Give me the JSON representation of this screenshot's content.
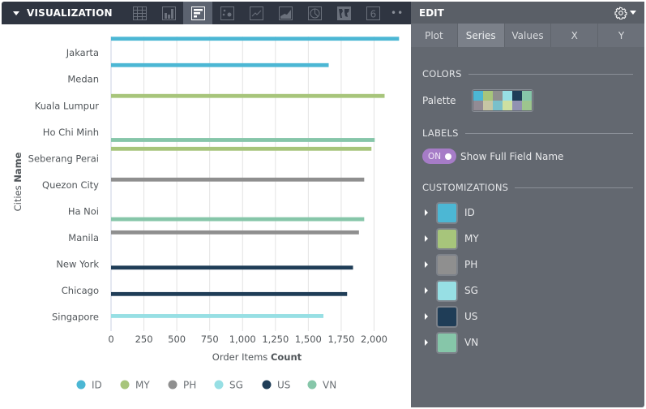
{
  "toolbar": {
    "title": "VISUALIZATION",
    "icons": [
      {
        "name": "table-icon",
        "active": false
      },
      {
        "name": "column-chart-icon",
        "active": false
      },
      {
        "name": "bar-chart-icon",
        "active": true
      },
      {
        "name": "scatter-chart-icon",
        "active": false
      },
      {
        "name": "line-chart-icon",
        "active": false
      },
      {
        "name": "area-chart-icon",
        "active": false
      },
      {
        "name": "pie-chart-icon",
        "active": false
      },
      {
        "name": "map-icon",
        "active": false
      },
      {
        "name": "single-value-icon",
        "active": false
      }
    ],
    "single_value_glyph": "6",
    "more_glyph": "••"
  },
  "edit": {
    "title": "EDIT",
    "tabs": [
      {
        "label": "Plot",
        "active": false
      },
      {
        "label": "Series",
        "active": true
      },
      {
        "label": "Values",
        "active": false
      },
      {
        "label": "X",
        "active": false
      },
      {
        "label": "Y",
        "active": false
      }
    ],
    "colors_heading": "COLORS",
    "palette_label": "Palette",
    "palette": [
      "#4cb7d4",
      "#a7c57b",
      "#8f8f8f",
      "#97dfe4",
      "#1f3d57",
      "#86c6a9",
      "#928b94",
      "#c6c6a4",
      "#7ac0ca",
      "#cde0a1",
      "#9191b2",
      "#9dc58e"
    ],
    "labels_heading": "LABELS",
    "toggle_state": "ON",
    "toggle_label": "Show Full Field Name",
    "customizations_heading": "CUSTOMIZATIONS",
    "customizations": [
      {
        "name": "ID",
        "color": "#4cb7d4"
      },
      {
        "name": "MY",
        "color": "#a7c57b"
      },
      {
        "name": "PH",
        "color": "#8f8f8f"
      },
      {
        "name": "SG",
        "color": "#97dfe4"
      },
      {
        "name": "US",
        "color": "#1f3d57"
      },
      {
        "name": "VN",
        "color": "#86c6a9"
      }
    ]
  },
  "chart_data": {
    "type": "bar",
    "orientation": "horizontal",
    "title": "",
    "xlabel_prefix": "Order Items ",
    "xlabel_bold": "Count",
    "ylabel_prefix": "Cities ",
    "ylabel_bold": "Name",
    "xlim": [
      0,
      2200
    ],
    "xticks": [
      0,
      250,
      500,
      750,
      1000,
      1250,
      1500,
      1750,
      2000
    ],
    "xtick_labels": [
      "0",
      "250",
      "500",
      "750",
      "1,000",
      "1,250",
      "1,500",
      "1,750",
      "2,000"
    ],
    "grid": true,
    "legend_position": "bottom",
    "categories": [
      "Jakarta",
      "Medan",
      "Kuala Lumpur",
      "Ho Chi Minh",
      "Seberang Perai",
      "Quezon City",
      "Ha Noi",
      "Manila",
      "New York",
      "Chicago",
      "Singapore"
    ],
    "series": [
      {
        "name": "ID",
        "color": "#4cb7d4",
        "values": [
          2190,
          1655,
          null,
          null,
          null,
          null,
          null,
          null,
          null,
          null,
          null
        ]
      },
      {
        "name": "MY",
        "color": "#a7c57b",
        "values": [
          null,
          null,
          2080,
          null,
          1980,
          null,
          null,
          null,
          null,
          null,
          null
        ]
      },
      {
        "name": "PH",
        "color": "#8f8f8f",
        "values": [
          null,
          null,
          null,
          null,
          null,
          1925,
          null,
          1885,
          null,
          null,
          null
        ]
      },
      {
        "name": "SG",
        "color": "#97dfe4",
        "values": [
          null,
          null,
          null,
          null,
          null,
          null,
          null,
          null,
          null,
          null,
          1615
        ]
      },
      {
        "name": "US",
        "color": "#1f3d57",
        "values": [
          null,
          null,
          null,
          null,
          null,
          null,
          null,
          null,
          1840,
          1795,
          null
        ]
      },
      {
        "name": "VN",
        "color": "#86c6a9",
        "values": [
          null,
          null,
          null,
          2005,
          null,
          null,
          1925,
          null,
          null,
          null,
          null
        ]
      }
    ]
  }
}
